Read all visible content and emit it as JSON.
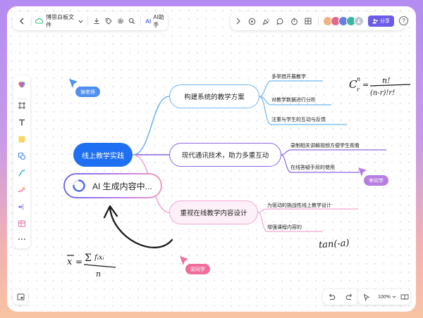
{
  "toolbar": {
    "doc_title": "博思白板文件",
    "ai_label": "AI助手",
    "share_label": "分享",
    "help_label": "?"
  },
  "mindmap": {
    "center": "线上教学实践",
    "ai_node": "AI 生成内容中...",
    "branches": [
      {
        "label": "构建系统的教学方案",
        "color": "#6fb6f0",
        "leaves": [
          "多举措开展教学",
          "对教学数据进行分析",
          "注重与学生的互动与反馈"
        ]
      },
      {
        "label": "现代通讯技术，助力多重互动",
        "color": "#8a64e6",
        "leaves": [
          "录制相关讲解视频方便学生观看",
          "在线答疑手段的使用"
        ]
      },
      {
        "label": "重视在线教学内容设计",
        "color": "#f0a6d4",
        "leaves": [
          "为驱动的挑战性线上教学设计",
          "增强课程内容的"
        ]
      }
    ]
  },
  "cursors": [
    {
      "name": "谢老师",
      "color": "#4f8ff0"
    },
    {
      "name": "李同学",
      "color": "#b77de0"
    },
    {
      "name": "梁同学",
      "color": "#f06d9c"
    }
  ],
  "handwriting": {
    "formula_combination": "C_r^n = n! / (n-r)! r!",
    "formula_tan": "tan(-a)",
    "formula_mean": "x̄ = Σ f_i x_i / n"
  },
  "bottom": {
    "zoom": "100%"
  },
  "colors": {
    "accent": "#6d5ce8",
    "main_node": "#1f6ff2"
  }
}
